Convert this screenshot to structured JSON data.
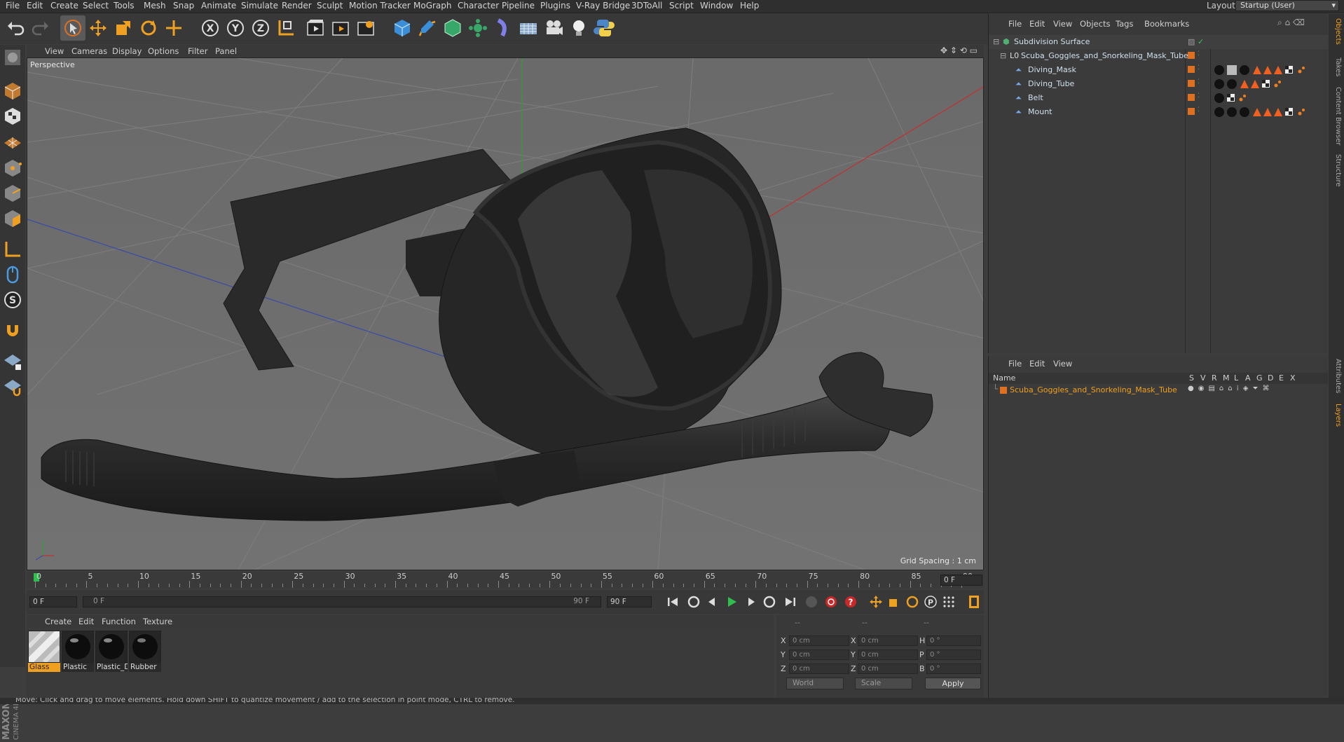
{
  "menu": [
    "File",
    "Edit",
    "Create",
    "Select",
    "Tools",
    "Mesh",
    "Snap",
    "Animate",
    "Simulate",
    "Render",
    "Sculpt",
    "Motion Tracker",
    "MoGraph",
    "Character",
    "Pipeline",
    "Plugins",
    "V-Ray Bridge",
    "3DToAll",
    "Script",
    "Window",
    "Help"
  ],
  "layout": {
    "label": "Layout:",
    "value": "Startup (User)"
  },
  "toolbar_icons": [
    "undo-icon",
    "redo-icon",
    "live-select-icon",
    "move-icon",
    "scale-icon",
    "rotate-icon",
    "last-tool-icon",
    "x-axis-icon",
    "y-axis-icon",
    "z-axis-icon",
    "world-coord-icon",
    "render-view-icon",
    "render-picture-queue-icon",
    "render-settings-icon",
    "cube-icon",
    "pen-spline-icon",
    "subdivision-icon",
    "array-icon",
    "deformer-icon",
    "floor-icon",
    "camera-icon",
    "light-icon",
    "python-icon"
  ],
  "left_tools": [
    "make-editable-icon",
    "model-mode-icon",
    "texture-mode-icon",
    "workplane-icon",
    "points-mode-icon",
    "edges-mode-icon",
    "polygons-mode-icon",
    "axis-icon",
    "tweak-icon",
    "snap-s-icon",
    "magnet-icon",
    "lock-grid-icon",
    "grid-snap-icon"
  ],
  "viewport": {
    "menu": [
      "View",
      "Cameras",
      "Display",
      "Options",
      "Filter",
      "Panel"
    ],
    "label": "Perspective",
    "grid_spacing": "Grid Spacing : 1 cm"
  },
  "timeline": {
    "ticks": [
      "0",
      "5",
      "10",
      "15",
      "20",
      "25",
      "30",
      "35",
      "40",
      "45",
      "50",
      "55",
      "60",
      "65",
      "70",
      "75",
      "80",
      "85",
      "90"
    ],
    "current_frame": "0 F",
    "start_field": "0 F",
    "range_start": "0 F",
    "range_end": "90 F",
    "end_field": "90 F"
  },
  "materials": {
    "menu": [
      "Create",
      "Edit",
      "Function",
      "Texture"
    ],
    "items": [
      {
        "name": "Glass",
        "selected": true
      },
      {
        "name": "Plastic",
        "selected": false
      },
      {
        "name": "Plastic_D",
        "selected": false
      },
      {
        "name": "Rubber",
        "selected": false
      }
    ]
  },
  "coordinates": {
    "header": [
      "--",
      "--",
      "--"
    ],
    "rows": [
      {
        "a": "X",
        "v1": "0 cm",
        "b": "X",
        "v2": "0 cm",
        "c": "H",
        "v3": "0 °"
      },
      {
        "a": "Y",
        "v1": "0 cm",
        "b": "Y",
        "v2": "0 cm",
        "c": "P",
        "v3": "0 °"
      },
      {
        "a": "Z",
        "v1": "0 cm",
        "b": "Z",
        "v2": "0 cm",
        "c": "B",
        "v3": "0 °"
      }
    ],
    "mode": "World",
    "size_mode": "Scale",
    "apply": "Apply"
  },
  "object_manager": {
    "menu": [
      "File",
      "Edit",
      "View",
      "Objects",
      "Tags",
      "Bookmarks"
    ],
    "objects": [
      {
        "name": "Subdivision Surface",
        "level": 0
      },
      {
        "name": "Scuba_Goggles_and_Snorkeling_Mask_Tube",
        "level": 1
      },
      {
        "name": "Diving_Mask",
        "level": 2
      },
      {
        "name": "Diving_Tube",
        "level": 2
      },
      {
        "name": "Belt",
        "level": 2
      },
      {
        "name": "Mount",
        "level": 2
      }
    ]
  },
  "layer_manager": {
    "menu": [
      "File",
      "Edit",
      "View"
    ],
    "columns": [
      "Name",
      "S",
      "V",
      "R",
      "M",
      "L",
      "A",
      "G",
      "D",
      "E",
      "X"
    ],
    "layer": "Scuba_Goggles_and_Snorkeling_Mask_Tube"
  },
  "right_tabs": [
    "Objects",
    "Takes",
    "Content Browser",
    "Structure",
    "Attributes",
    "Layers"
  ],
  "status": "Move: Click and drag to move elements. Hold down SHIFT to quantize movement / add to the selection in point mode, CTRL to remove.",
  "colors": {
    "accent": "#f0a020",
    "viewport_bg": "#6e6e6e",
    "panel_bg": "#3b3b3b",
    "layer_color": "#e07020"
  }
}
